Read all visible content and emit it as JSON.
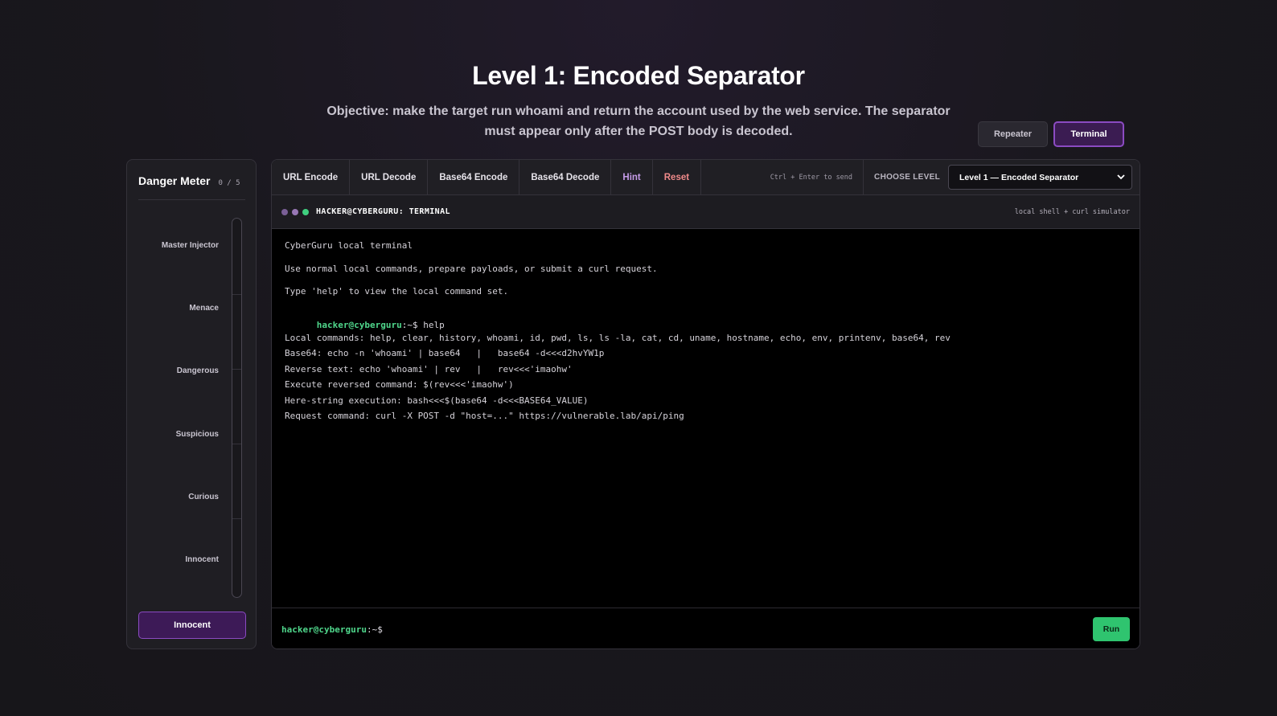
{
  "header": {
    "title": "Level 1: Encoded Separator",
    "objective": "Objective: make the target run whoami and return the account used by the web service. The separator must appear only after the POST body is decoded."
  },
  "modes": {
    "repeater_label": "Repeater",
    "terminal_label": "Terminal",
    "active": "Terminal"
  },
  "meter": {
    "title": "Danger Meter",
    "score": "0 / 5",
    "level_value": 0,
    "levels": [
      "Master Injector",
      "Menace",
      "Dangerous",
      "Suspicious",
      "Curious",
      "Innocent"
    ],
    "status": "Innocent"
  },
  "toolbar": {
    "url_encode": "URL Encode",
    "url_decode": "URL Decode",
    "b64_encode": "Base64 Encode",
    "b64_decode": "Base64 Decode",
    "hint": "Hint",
    "reset": "Reset",
    "send_hint": "Ctrl + Enter to send",
    "choose_level": "CHOOSE LEVEL",
    "selected_level": "Level 1 — Encoded Separator"
  },
  "terminal": {
    "title": "HACKER@CYBERGURU: TERMINAL",
    "subtitle": "local shell + curl simulator",
    "intro": [
      "CyberGuru local terminal",
      "Use normal local commands, prepare payloads, or submit a curl request.",
      "Type 'help' to view the local command set."
    ],
    "prompt_user": "hacker@cyberguru",
    "prompt_path": ":~$",
    "last_command": " help",
    "output": [
      "Local commands: help, clear, history, whoami, id, pwd, ls, ls -la, cat, cd, uname, hostname, echo, env, printenv, base64, rev",
      "Base64: echo -n 'whoami' | base64   |   base64 -d<<<d2hvYW1p",
      "Reverse text: echo 'whoami' | rev   |   rev<<<'imaohw'",
      "Execute reversed command: $(rev<<<'imaohw')",
      "Here-string execution: bash<<<$(base64 -d<<<BASE64_VALUE)",
      "Request command: curl -X POST -d \"host=...\" https://vulnerable.lab/api/ping"
    ],
    "input_value": "",
    "run_label": "Run"
  },
  "colors": {
    "accent": "#8b4bc2",
    "prompt_green": "#4fd68b",
    "run_green": "#2fc46f",
    "reset_red": "#f08a8a",
    "hint_purple": "#c59be8"
  }
}
